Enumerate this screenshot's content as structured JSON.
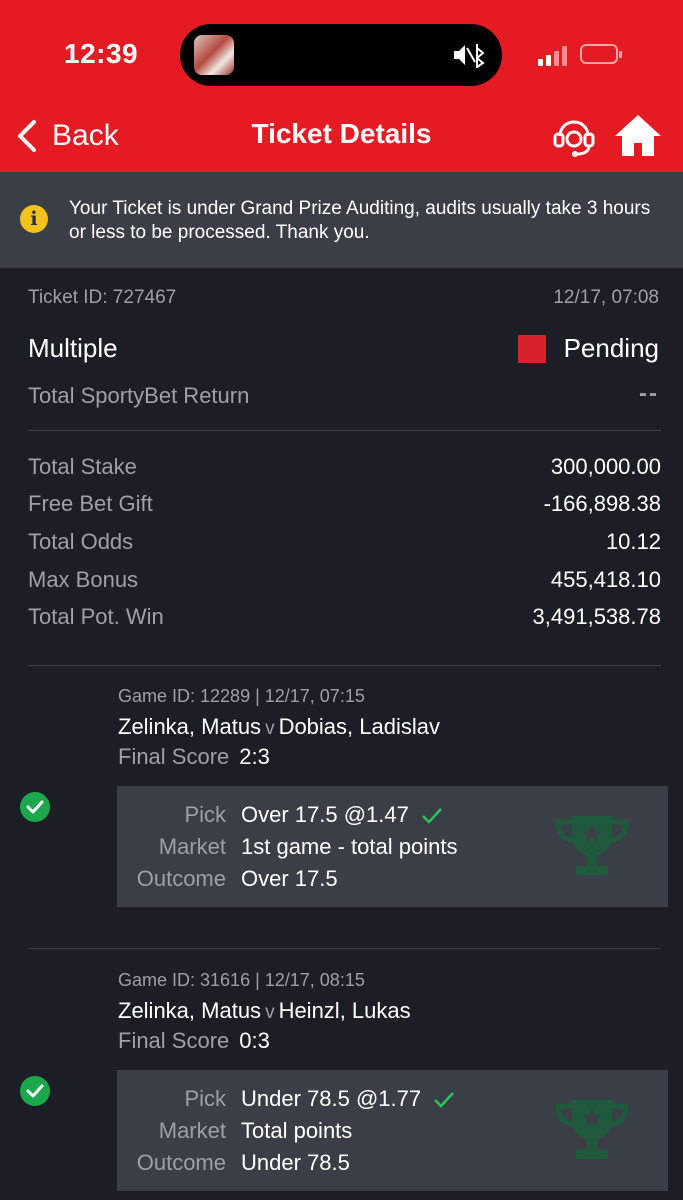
{
  "status_bar": {
    "time": "12:39"
  },
  "header": {
    "back_label": "Back",
    "title": "Ticket Details",
    "icons": [
      "support-headset-icon",
      "home-icon"
    ]
  },
  "notice": {
    "icon": "info-icon",
    "text": "Your Ticket is under Grand Prize Auditing, audits usually take 3 hours or less to be processed. Thank you."
  },
  "ticket": {
    "id": "Ticket ID: 727467",
    "date": "12/17, 07:08",
    "type": "Multiple",
    "status": "Pending",
    "status_color": "#d9202c",
    "return_label": "Total SportyBet Return",
    "return_value": "--"
  },
  "summary": [
    {
      "label": "Total Stake",
      "value": "300,000.00"
    },
    {
      "label": "Free Bet Gift",
      "value": "-166,898.38"
    },
    {
      "label": "Total Odds",
      "value": "10.12"
    },
    {
      "label": "Max Bonus",
      "value": "455,418.10"
    },
    {
      "label": "Total Pot. Win",
      "value": "3,491,538.78"
    }
  ],
  "selections": [
    {
      "game_meta": "Game ID: 12289 | 12/17, 07:15",
      "home": "Zelinka, Matus",
      "vs": "v",
      "away": "Dobias, Ladislav",
      "score_label": "Final Score",
      "score": "2:3",
      "pick_label": "Pick",
      "pick": "Over 17.5 @1.47",
      "market_label": "Market",
      "market": "1st game - total points",
      "outcome_label": "Outcome",
      "outcome": "Over 17.5",
      "won": true
    },
    {
      "game_meta": "Game ID: 31616 | 12/17, 08:15",
      "home": "Zelinka, Matus",
      "vs": "v",
      "away": "Heinzl, Lukas",
      "score_label": "Final Score",
      "score": "0:3",
      "pick_label": "Pick",
      "pick": "Under 78.5 @1.77",
      "market_label": "Market",
      "market": "Total points",
      "outcome_label": "Outcome",
      "outcome": "Under 78.5",
      "won": true
    }
  ],
  "colors": {
    "header": "#e41b23",
    "background": "#1b1e24",
    "card": "#3a3e46",
    "win": "#1ba84a",
    "notice_icon": "#f4c21a"
  }
}
